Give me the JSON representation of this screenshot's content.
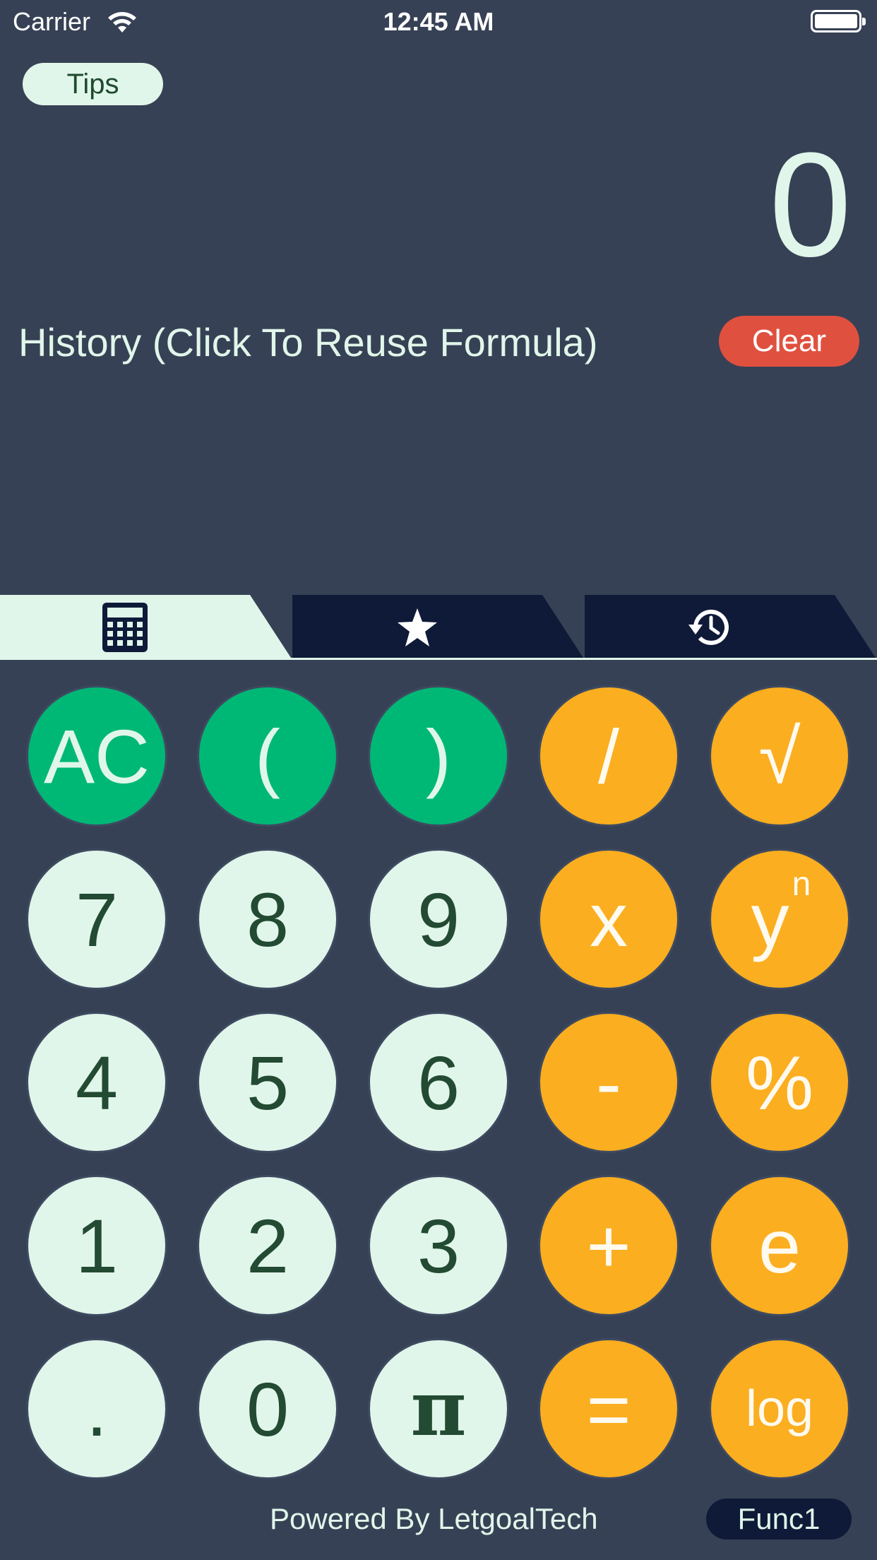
{
  "status_bar": {
    "carrier": "Carrier",
    "time": "12:45 AM"
  },
  "tips_label": "Tips",
  "display": {
    "value": "0"
  },
  "history": {
    "title": "History (Click To Reuse Formula)",
    "clear_label": "Clear"
  },
  "tabs": [
    {
      "icon": "calculator-icon",
      "active": true
    },
    {
      "icon": "star-icon",
      "active": false
    },
    {
      "icon": "history-icon",
      "active": false
    }
  ],
  "keys": {
    "ac": "AC",
    "lparen": "(",
    "rparen": ")",
    "divide": "/",
    "sqrt": "√",
    "k7": "7",
    "k8": "8",
    "k9": "9",
    "multiply": "x",
    "power_base": "y",
    "power_exp": "n",
    "k4": "4",
    "k5": "5",
    "k6": "6",
    "minus": "-",
    "percent": "%",
    "k1": "1",
    "k2": "2",
    "k3": "3",
    "plus": "+",
    "e": "e",
    "dot": ".",
    "k0": "0",
    "pi": "π",
    "equals": "=",
    "log": "log"
  },
  "footer": {
    "powered_by": "Powered By LetgoalTech",
    "func_label": "Func1"
  },
  "colors": {
    "background": "#374155",
    "green": "#00b876",
    "light": "#e1f6ea",
    "orange": "#fbae1f",
    "clear": "#e0503f",
    "navy": "#0f1a38"
  }
}
